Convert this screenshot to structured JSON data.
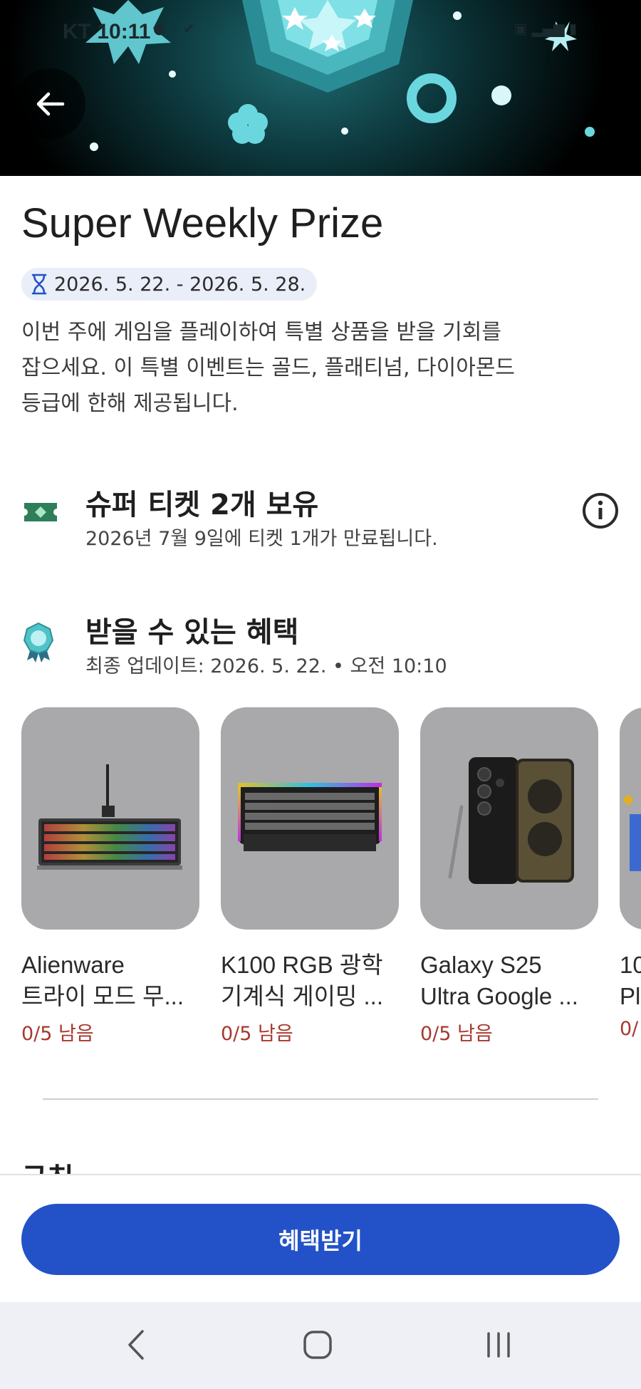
{
  "status_bar": {
    "time": "KT 10:11",
    "left_icons": [
      "talk-icon",
      "sol-pay-icon",
      "check-icon"
    ],
    "right_icons": [
      "5g-icon",
      "signal-icon",
      "battery-icon"
    ]
  },
  "header": {
    "back_icon": "arrow-left-icon"
  },
  "event": {
    "title": "Super Weekly Prize",
    "date_range": "2026. 5. 22. - 2026. 5. 28.",
    "description_lines": [
      "이번 주에 게임을 플레이하여 특별 상품을 받을 기회를",
      "잡으세요. 이 특별 이벤트는 골드, 플래티넘, 다이아몬드",
      "등급에 한해 제공됩니다."
    ]
  },
  "tickets": {
    "title": "슈퍼 티켓 2개 보유",
    "subtitle": "2026년 7월 9일에 티켓 1개가 만료됩니다."
  },
  "rewards": {
    "title": "받을 수 있는 혜택",
    "subtitle": "최종 업데이트: 2026. 5. 22. • 오전 10:10",
    "items": [
      {
        "name_line1": "Alienware",
        "name_line2": "트라이 모드 무...",
        "remaining": "0/5 남음"
      },
      {
        "name_line1": "K100 RGB 광학",
        "name_line2": "기계식 게이밍 ...",
        "remaining": "0/5 남음"
      },
      {
        "name_line1": "Galaxy S25",
        "name_line2": "Ultra Google ...",
        "remaining": "0/5 남음"
      },
      {
        "name_line1": "10",
        "name_line2": "Pl",
        "remaining": "0/"
      }
    ]
  },
  "next_section": {
    "partial_heading": "규칙"
  },
  "cta": {
    "label": "혜택받기"
  },
  "colors": {
    "accent": "#2352c8",
    "remaining_text": "#a8382e",
    "ticket_green": "#2e7d5b",
    "badge_teal": "#4fc3c8"
  }
}
